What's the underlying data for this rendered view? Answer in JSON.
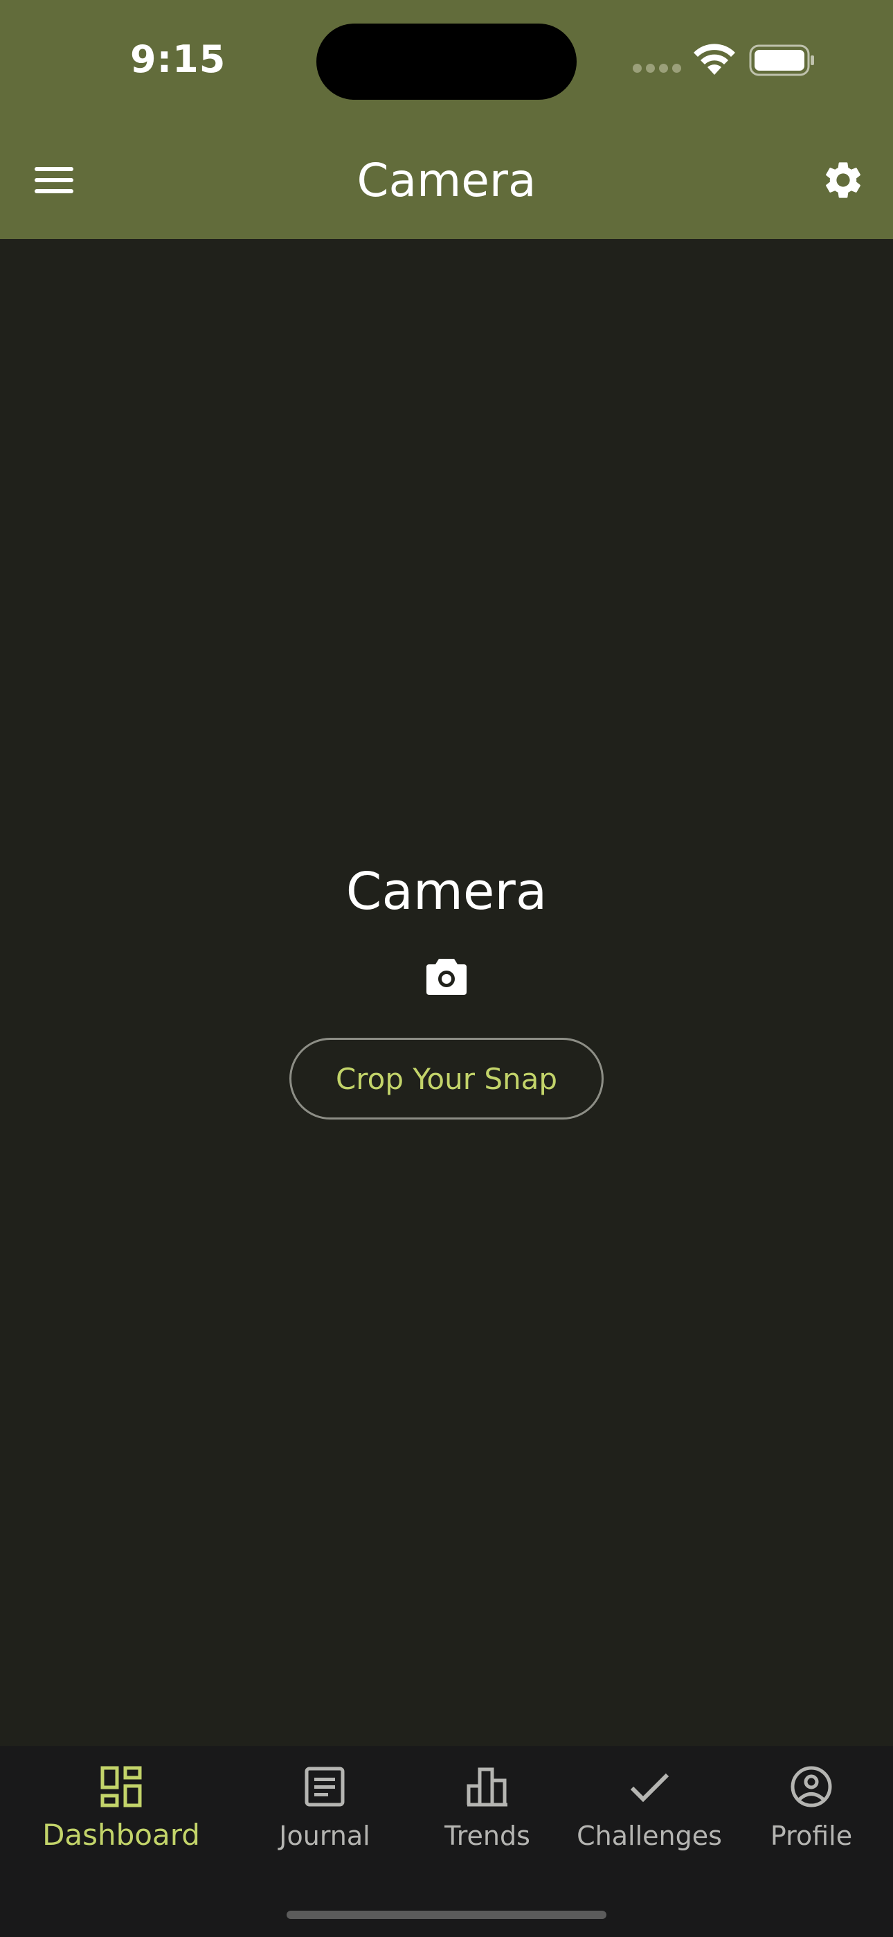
{
  "status_bar": {
    "time": "9:15"
  },
  "app_bar": {
    "title": "Camera",
    "menu_icon": "hamburger-menu-icon",
    "settings_icon": "gear-icon"
  },
  "main": {
    "title": "Camera",
    "icon": "camera-icon",
    "button_label": "Crop Your Snap"
  },
  "bottom_nav": {
    "items": [
      {
        "label": "Dashboard",
        "icon": "dashboard-icon",
        "active": true
      },
      {
        "label": "Journal",
        "icon": "journal-icon",
        "active": false
      },
      {
        "label": "Trends",
        "icon": "bar-chart-icon",
        "active": false
      },
      {
        "label": "Challenges",
        "icon": "checkmark-icon",
        "active": false
      },
      {
        "label": "Profile",
        "icon": "profile-icon",
        "active": false
      }
    ]
  },
  "colors": {
    "app_bar": "#626c3b",
    "background": "#20211b",
    "accent": "#c3d46a",
    "nav_background": "#19191a",
    "inactive": "#b5b5b2"
  }
}
